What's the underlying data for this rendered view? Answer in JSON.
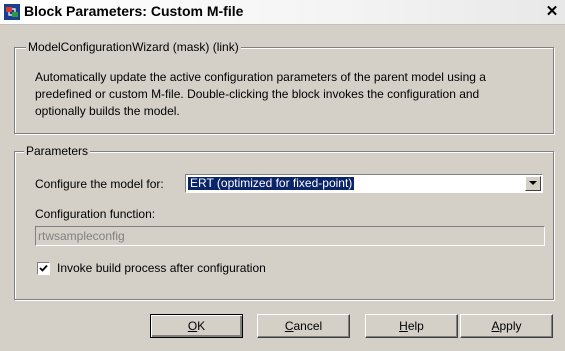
{
  "window": {
    "title": "Block Parameters: Custom M-file",
    "close_glyph": "✕"
  },
  "mask_group": {
    "legend": "ModelConfigurationWizard (mask) (link)",
    "description_lines": [
      "Automatically update the active configuration parameters of the parent model using a",
      "predefined or custom M-file.  Double-clicking the block invokes the configuration and",
      "optionally builds the model."
    ]
  },
  "parameters_group": {
    "legend": "Parameters",
    "configure_label": "Configure the model for:",
    "configure_value": "ERT (optimized for fixed-point)",
    "config_function_label": "Configuration function:",
    "config_function_value": "rtwsampleconfig",
    "invoke_build_label": "Invoke build process after configuration",
    "invoke_build_checked": true
  },
  "buttons": {
    "ok": {
      "mnemonic": "O",
      "rest": "K"
    },
    "cancel": {
      "mnemonic": "C",
      "rest": "ancel"
    },
    "help": {
      "mnemonic": "H",
      "rest": "elp"
    },
    "apply": {
      "mnemonic": "A",
      "rest": "pply"
    }
  },
  "icons": {
    "app": "simulink-block-icon",
    "dropdown": "chevron-down-icon",
    "check": "checkmark-icon"
  }
}
